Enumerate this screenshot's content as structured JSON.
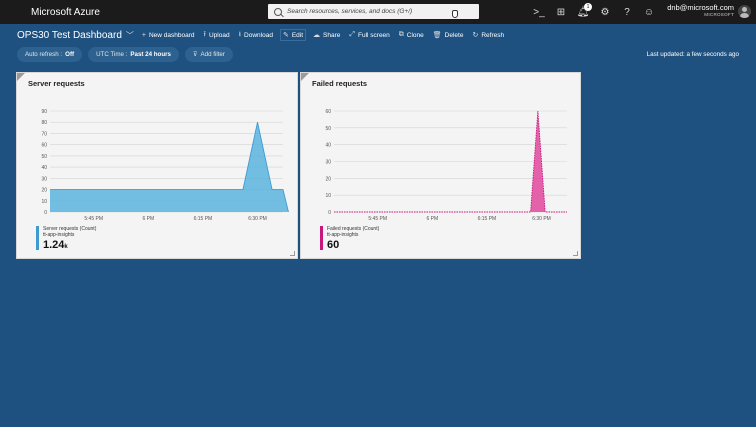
{
  "app": {
    "brand": "Microsoft Azure",
    "search_placeholder": "Search resources, services, and docs (G+/)",
    "user_email": "dnb@microsoft.com",
    "user_org": "MICROSOFT",
    "notification_count": "1",
    "icons": [
      "cloud-shell-icon",
      "directory-filter-icon",
      "notifications-icon",
      "settings-icon",
      "help-icon",
      "feedback-icon"
    ]
  },
  "dashboard": {
    "title": "OPS30 Test Dashboard",
    "toolbar": [
      {
        "id": "new-dashboard",
        "icon": "+",
        "label": "New dashboard"
      },
      {
        "id": "upload",
        "icon": "⭱",
        "label": "Upload"
      },
      {
        "id": "download",
        "icon": "⭳",
        "label": "Download"
      },
      {
        "id": "edit",
        "icon": "✎",
        "label": "Edit"
      },
      {
        "id": "share",
        "icon": "☁",
        "label": "Share"
      },
      {
        "id": "full-screen",
        "icon": "⤢",
        "label": "Full screen"
      },
      {
        "id": "clone",
        "icon": "⧉",
        "label": "Clone"
      },
      {
        "id": "delete",
        "icon": "🗑",
        "label": "Delete"
      },
      {
        "id": "refresh",
        "icon": "↻",
        "label": "Refresh"
      }
    ],
    "filters": {
      "auto_refresh_label": "Auto refresh :",
      "auto_refresh_value": "Off",
      "time_label": "UTC Time :",
      "time_value": "Past 24 hours",
      "add_filter_label": "Add filter"
    },
    "last_updated": "Last updated: a few seconds ago"
  },
  "chart_data": [
    {
      "type": "area",
      "title": "Server requests",
      "color": "#5ab4de",
      "line_color": "#3d9bd0",
      "ylim": [
        0,
        90
      ],
      "yticks": [
        0,
        10,
        20,
        30,
        40,
        50,
        60,
        70,
        80,
        90
      ],
      "x_tick_labels": [
        "5:45 PM",
        "6 PM",
        "6:15 PM",
        "6:30 PM"
      ],
      "x_tick_minutes": [
        345,
        360,
        375,
        390
      ],
      "xlim": [
        333,
        397
      ],
      "points": [
        [
          333,
          20
        ],
        [
          375,
          20
        ],
        [
          386,
          20
        ],
        [
          390,
          80
        ],
        [
          394,
          20
        ],
        [
          397,
          20
        ],
        [
          398.5,
          0
        ]
      ],
      "legend_name": "Server requests (Count)",
      "legend_source": "tt-app-insights",
      "legend_value": "1.24",
      "legend_unit": "k"
    },
    {
      "type": "area",
      "title": "Failed requests",
      "color": "#e0489c",
      "line_color": "#c8167e",
      "ylim": [
        0,
        60
      ],
      "yticks": [
        0,
        10,
        20,
        30,
        40,
        50,
        60
      ],
      "x_tick_labels": [
        "5:45 PM",
        "6 PM",
        "6:15 PM",
        "6:30 PM"
      ],
      "x_tick_minutes": [
        345,
        360,
        375,
        390
      ],
      "xlim": [
        333,
        397
      ],
      "points": [
        [
          333,
          0
        ],
        [
          387,
          0
        ],
        [
          389,
          60
        ],
        [
          391,
          0
        ],
        [
          397,
          0
        ]
      ],
      "legend_name": "Failed requests (Count)",
      "legend_source": "tt-app-insights",
      "legend_value": "60",
      "legend_unit": ""
    }
  ]
}
